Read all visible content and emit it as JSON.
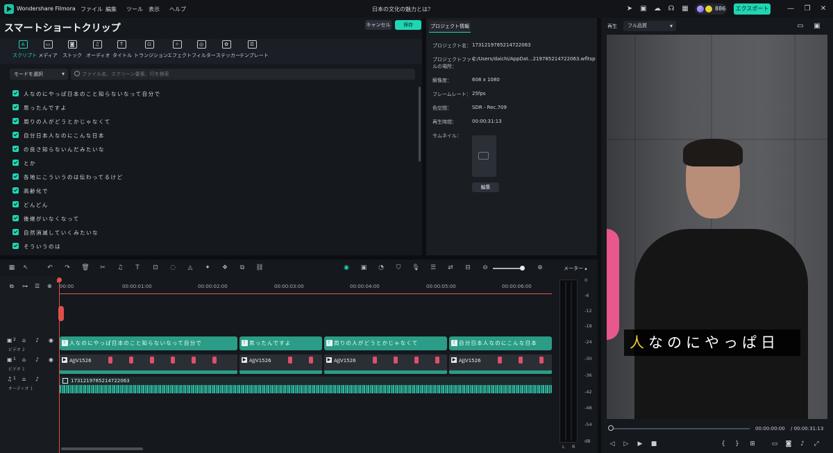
{
  "titlebar": {
    "app_name": "Wondershare Filmora",
    "menus": [
      "ファイル",
      "編集",
      "ツール",
      "表示",
      "ヘルプ"
    ],
    "doc_title": "日本の文化の魅力とは？",
    "credits": "886",
    "export_label": "エクスポート ⌄"
  },
  "left_panel": {
    "title": "スマートショートクリップ",
    "cancel_label": "キャンセル",
    "save_label": "保存",
    "tabs": [
      "スクリプト",
      "メディア",
      "ストック",
      "オーディオ",
      "タイトル",
      "トランジション",
      "エフェクト",
      "フィルター",
      "ステッカー",
      "テンプレート"
    ],
    "tab_icons": [
      "A",
      "▭",
      "◙",
      "♫",
      "T",
      "⊡",
      "✧",
      "◎",
      "✿",
      "☰"
    ],
    "mode_select": "モードを選択",
    "search_placeholder": "ファイル名、スクリーン要素、行を検索",
    "script_lines": [
      "人なのにやっぱ日本のこと知らないなって自分で",
      "思ったんですよ",
      "周りの人がどうとかじゃなくて",
      "自分日本人なのにこんな日本",
      "の良さ知らないんだみたいな",
      "とか",
      "各地にこういうのは伝わってるけど",
      "高齢化で",
      "どんどん",
      "後継がいなくなって",
      "自然消滅していくみたいな",
      "そういうのは"
    ]
  },
  "project_info": {
    "tab_label": "プロジェクト情報",
    "name_label": "プロジェクト名：",
    "name_value": "1731219785214722063",
    "location_label_1": "プロジェクトファイ",
    "location_label_2": "ルの場所：",
    "location_value": "C:/Users/daichi/AppDat...219785214722063.wfltsp",
    "resolution_label": "解像度：",
    "resolution_value": "608 x 1080",
    "framerate_label": "フレームレート：",
    "framerate_value": "25fps",
    "colorspace_label": "色空間：",
    "colorspace_value": "SDR - Rec.709",
    "duration_label": "再生時間：",
    "duration_value": "00:00:31:13",
    "thumbnail_label": "サムネイル：",
    "edit_label": "編集"
  },
  "preview": {
    "play_label": "再生",
    "quality": "フル品質",
    "caption_highlight": "人",
    "caption_rest": "なのにやっぱ日",
    "time_current": "00:00:00:00",
    "time_total": "/ 00:00:31:13"
  },
  "timeline": {
    "ruler_ticks": [
      "00:00",
      "00:00:01:00",
      "00:00:02:00",
      "00:00:03:00",
      "00:00:04:00",
      "00:00:05:00",
      "00:00:06:00"
    ],
    "track_labels": [
      "ビデオ 2",
      "ビデオ 1",
      "オーディオ 1"
    ],
    "track_nums": [
      "2",
      "1",
      "1"
    ],
    "title_clips": [
      "人なのにやっぱ日本のこと知らないなって自分で",
      "思ったんですよ",
      "周りの人がどうとかじゃなくて",
      "自分日本人なのにこんな日本"
    ],
    "video_clips": [
      "AJJV1526",
      "AJJV1526",
      "AJJV1526",
      "AJJV1526"
    ],
    "audio_clip": "1731219785214722063"
  },
  "meter": {
    "title": "メーター ▴",
    "ticks": [
      "0",
      "-6",
      "-12",
      "-18",
      "-24",
      "-30",
      "-36",
      "-42",
      "-48",
      "-54",
      "dB"
    ],
    "channels": [
      "L",
      "R"
    ]
  },
  "colors": {
    "accent": "#1fd6b3",
    "playhead": "#e0504b",
    "caption_highlight": "#f2d03a"
  }
}
